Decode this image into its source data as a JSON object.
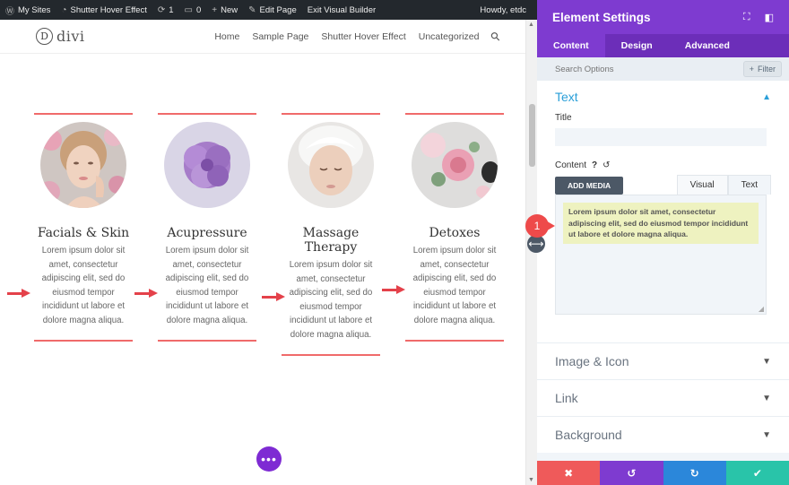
{
  "adminbar": {
    "items": [
      {
        "icon": "wordpress-icon",
        "glyph": "Ⓦ",
        "label": "My Sites"
      },
      {
        "icon": "dashboard-icon",
        "glyph": "◔",
        "label": "Shutter Hover Effect"
      },
      {
        "icon": "updates-icon",
        "glyph": "⟳",
        "label": "1"
      },
      {
        "icon": "comments-icon",
        "glyph": "▭",
        "label": "0"
      },
      {
        "icon": "plus-icon",
        "glyph": "+",
        "label": "New"
      },
      {
        "icon": "edit-icon",
        "glyph": "✎",
        "label": "Edit Page"
      },
      {
        "icon": "",
        "glyph": "",
        "label": "Exit Visual Builder"
      }
    ],
    "howdy": "Howdy, etdc"
  },
  "site": {
    "logo_letter": "D",
    "logo_word": "divi",
    "nav": [
      "Home",
      "Sample Page",
      "Shutter Hover Effect",
      "Uncategorized"
    ]
  },
  "cards": [
    {
      "title": "Facials & Skin",
      "body": "Lorem ipsum dolor sit amet, consectetur adipiscing elit, sed do eiusmod tempor incididunt ut labore et dolore magna aliqua.",
      "image": "woman-face-flowers"
    },
    {
      "title": "Acupressure",
      "body": "Lorem ipsum dolor sit amet, consectetur adipiscing elit, sed do eiusmod tempor incididunt ut labore et dolore magna aliqua.",
      "image": "purple-flower"
    },
    {
      "title": "Massage Therapy",
      "body": "Lorem ipsum dolor sit amet, consectetur adipiscing elit, sed do eiusmod tempor incididunt ut labore et dolore magna aliqua.",
      "image": "woman-spa-towel"
    },
    {
      "title": "Detoxes",
      "body": "Lorem ipsum dolor sit amet, consectetur adipiscing elit, sed do eiusmod tempor incididunt ut labore et dolore magna aliqua.",
      "image": "pink-roses-stones"
    }
  ],
  "more_button": "•••",
  "panel": {
    "title": "Element Settings",
    "tabs": [
      "Content",
      "Design",
      "Advanced"
    ],
    "search_placeholder": "Search Options",
    "filter_label": "Filter",
    "text_section": "Text",
    "title_label": "Title",
    "content_label": "Content",
    "help_glyph": "?",
    "reset_glyph": "↺",
    "add_media": "ADD MEDIA",
    "editor_tabs": [
      "Visual",
      "Text"
    ],
    "editor_text": "Lorem ipsum dolor sit amet, consectetur adipiscing elit, sed do eiusmod tempor incididunt ut labore et dolore magna aliqua.",
    "collapsed_sections": [
      "Image & Icon",
      "Link",
      "Background"
    ],
    "footer": [
      {
        "name": "cancel",
        "glyph": "✖",
        "color": "#ef5a5a"
      },
      {
        "name": "undo",
        "glyph": "↺",
        "color": "#7e3bd0"
      },
      {
        "name": "redo",
        "glyph": "↻",
        "color": "#2b87da"
      },
      {
        "name": "save",
        "glyph": "✔",
        "color": "#29c4a9"
      }
    ]
  },
  "annotation_badge": "1",
  "colors": {
    "accent_red": "#f06a6a",
    "arrow_red": "#e4414a",
    "purple": "#7e3bd0",
    "blue": "#2a9fd8"
  }
}
